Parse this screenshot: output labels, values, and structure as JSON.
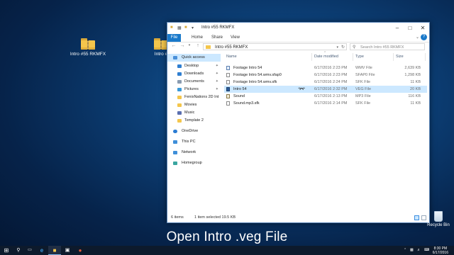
{
  "desktop": {
    "icons": [
      {
        "label": "Intro #55 RKMFX"
      },
      {
        "label": "Intro #"
      }
    ],
    "recycle_bin": "Recycle Bin"
  },
  "window": {
    "title": "Intro #55 RKMFX",
    "ribbon_tabs": [
      "File",
      "Home",
      "Share",
      "View"
    ],
    "help": "?",
    "address": "Intro #55 RKMFX",
    "search_placeholder": "Search Intro #55 RKMFX",
    "nav": [
      {
        "label": "Quick access",
        "icon_color": "#4a90d9",
        "pinned": false,
        "selected": true
      },
      {
        "label": "Desktop",
        "icon_color": "#2f7fd1",
        "pinned": true
      },
      {
        "label": "Downloads",
        "icon_color": "#2f7fd1",
        "pinned": true
      },
      {
        "label": "Documents",
        "icon_color": "#8a9bb0",
        "pinned": true
      },
      {
        "label": "Pictures",
        "icon_color": "#3a9ad9",
        "pinned": true
      },
      {
        "label": "FenixNations 2D Int",
        "icon_color": "#f4c64c",
        "pinned": false
      },
      {
        "label": "Movies",
        "icon_color": "#f4c64c",
        "pinned": false
      },
      {
        "label": "Music",
        "icon_color": "#5b6fb0",
        "pinned": false
      },
      {
        "label": "Template 2",
        "icon_color": "#f4c64c",
        "pinned": false
      },
      {
        "label": "OneDrive",
        "icon_color": "#2b7cd3",
        "pinned": false
      },
      {
        "label": "This PC",
        "icon_color": "#3f8fd9",
        "pinned": false
      },
      {
        "label": "Network",
        "icon_color": "#3f8fd9",
        "pinned": false
      },
      {
        "label": "Homegroup",
        "icon_color": "#3aa6a0",
        "pinned": false
      }
    ],
    "columns": [
      "Name",
      "Date modified",
      "Type",
      "Size"
    ],
    "files": [
      {
        "name": "Footage Intro 54",
        "date": "6/17/2016 2:23 PM",
        "type": "WMV File",
        "size": "2,639 KB",
        "icon": "wmv"
      },
      {
        "name": "Footage Intro 54.wmv.sfap0",
        "date": "6/17/2016 2:23 PM",
        "type": "SFAP0 File",
        "size": "1,298 KB",
        "icon": "doc"
      },
      {
        "name": "Footage Intro 54.wmv.sfk",
        "date": "6/17/2016 2:24 PM",
        "type": "SFK File",
        "size": "11 KB",
        "icon": "doc"
      },
      {
        "name": "Intro 54",
        "date": "6/17/2016 2:32 PM",
        "type": "VEG File",
        "size": "20 KB",
        "icon": "veg",
        "selected": true
      },
      {
        "name": "Sound",
        "date": "6/17/2016 2:13 PM",
        "type": "MP3 File",
        "size": "116 KB",
        "icon": "mp3"
      },
      {
        "name": "Sound.mp3.sfk",
        "date": "6/17/2016 2:14 PM",
        "type": "SFK File",
        "size": "11 KB",
        "icon": "doc"
      }
    ],
    "status": {
      "items": "6 items",
      "selection": "1 item selected  19.5 KB"
    }
  },
  "caption": "Open Intro .veg File",
  "taskbar": {
    "time": "8:30 PM",
    "date": "6/17/2016"
  }
}
